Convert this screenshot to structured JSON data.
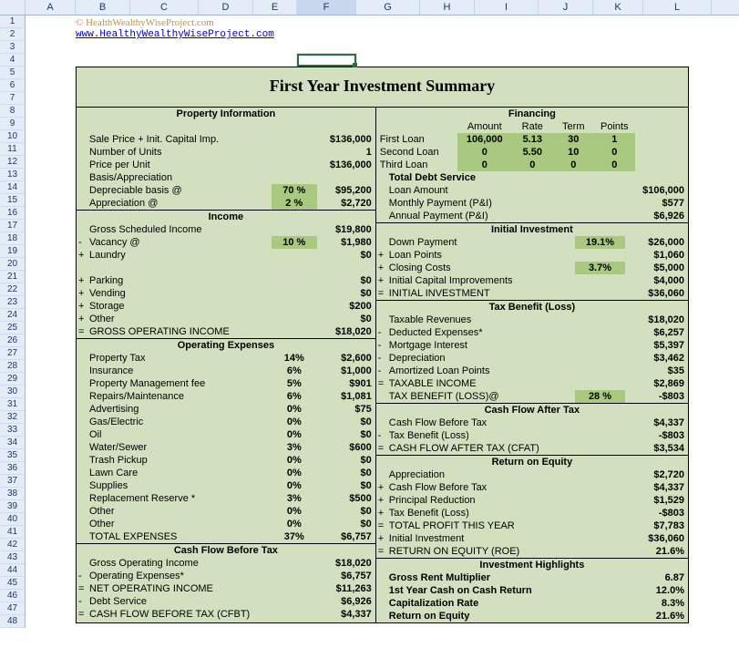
{
  "columns": [
    "",
    "A",
    "B",
    "C",
    "D",
    "E",
    "F",
    "G",
    "H",
    "I",
    "J",
    "K",
    "L"
  ],
  "rownums": [
    "1",
    "2",
    "3",
    "4",
    "5",
    "6",
    "7",
    "8",
    "9",
    "10",
    "11",
    "12",
    "13",
    "14",
    "15",
    "16",
    "17",
    "18",
    "19",
    "20",
    "21",
    "22",
    "23",
    "24",
    "25",
    "26",
    "27",
    "28",
    "29",
    "30",
    "31",
    "32",
    "33",
    "34",
    "35",
    "36",
    "37",
    "38",
    "39",
    "40",
    "41",
    "42",
    "43",
    "44",
    "45",
    "46",
    "47",
    "48"
  ],
  "copyright": "© HealthWealthyWiseProject.com",
  "weblink": "www.HealthyWealthyWiseProject.com",
  "title": "First Year Investment Summary",
  "propInfoHead": "Property Information",
  "propInfo": {
    "salePrice": {
      "lbl": "Sale Price + Init. Capital Imp.",
      "val": "$136,000"
    },
    "numUnits": {
      "lbl": "Number of Units",
      "val": "1"
    },
    "pricePerUnit": {
      "lbl": "Price per Unit",
      "val": "$136,000"
    },
    "basis": {
      "lbl": "Basis/Appreciation"
    },
    "depBasis": {
      "lbl": "Depreciable basis @",
      "pct": "70 %",
      "val": "$95,200"
    },
    "apprec": {
      "lbl": "Appreciation @",
      "pct": "2 %",
      "val": "$2,720"
    }
  },
  "incomeHead": "Income",
  "income": {
    "gsi": {
      "lbl": "Gross Scheduled Income",
      "val": "$19,800"
    },
    "vac": {
      "pfx": "-",
      "lbl": "Vacancy @",
      "pct": "10 %",
      "val": "$1,980"
    },
    "laundry": {
      "pfx": "+",
      "lbl": "Laundry",
      "val": "$0"
    },
    "parking": {
      "pfx": "+",
      "lbl": "Parking",
      "val": "$0"
    },
    "vending": {
      "pfx": "+",
      "lbl": "Vending",
      "val": "$0"
    },
    "storage": {
      "pfx": "+",
      "lbl": "Storage",
      "val": "$200"
    },
    "other": {
      "pfx": "+",
      "lbl": "Other",
      "val": "$0"
    },
    "goi": {
      "pfx": "=",
      "lbl": "GROSS OPERATING INCOME",
      "val": "$18,020"
    }
  },
  "opexHead": "Operating Expenses",
  "opex": {
    "tax": {
      "lbl": "Property Tax",
      "pct": "14%",
      "val": "$2,600"
    },
    "ins": {
      "lbl": "Insurance",
      "pct": "6%",
      "val": "$1,000"
    },
    "mgmt": {
      "lbl": "Property Management fee",
      "pct": "5%",
      "val": "$901"
    },
    "rep": {
      "lbl": "Repairs/Maintenance",
      "pct": "6%",
      "val": "$1,081"
    },
    "adv": {
      "lbl": "Advertising",
      "pct": "0%",
      "val": "$75"
    },
    "gas": {
      "lbl": "Gas/Electric",
      "pct": "0%",
      "val": "$0"
    },
    "oil": {
      "lbl": "Oil",
      "pct": "0%",
      "val": "$0"
    },
    "water": {
      "lbl": "Water/Sewer",
      "pct": "3%",
      "val": "$600"
    },
    "trash": {
      "lbl": "Trash Pickup",
      "pct": "0%",
      "val": "$0"
    },
    "lawn": {
      "lbl": "Lawn Care",
      "pct": "0%",
      "val": "$0"
    },
    "supp": {
      "lbl": "Supplies",
      "pct": "0%",
      "val": "$0"
    },
    "reserve": {
      "lbl": "Replacement Reserve *",
      "pct": "3%",
      "val": "$500"
    },
    "other1": {
      "lbl": "Other",
      "pct": "0%",
      "val": "$0"
    },
    "other2": {
      "lbl": "Other",
      "pct": "0%",
      "val": "$0"
    },
    "total": {
      "lbl": "TOTAL EXPENSES",
      "pct": "37%",
      "val": "$6,757"
    }
  },
  "cfbtHead": "Cash Flow Before Tax",
  "cfbt": {
    "goi": {
      "lbl": "Gross Operating Income",
      "val": "$18,020"
    },
    "opex": {
      "pfx": "-",
      "lbl": "Operating Expenses*",
      "val": "$6,757"
    },
    "noi": {
      "pfx": "=",
      "lbl": "NET OPERATING INCOME",
      "val": "$11,263"
    },
    "debt": {
      "pfx": "-",
      "lbl": "Debt Service",
      "val": "$6,926"
    },
    "cfbt": {
      "pfx": "=",
      "lbl": "CASH FLOW BEFORE TAX (CFBT)",
      "val": "$4,337"
    }
  },
  "finHead": "Financing",
  "finCols": {
    "amt": "Amount",
    "rate": "Rate",
    "term": "Term",
    "pts": "Points"
  },
  "fin": {
    "l1": {
      "name": "First Loan",
      "amt": "106,000",
      "rate": "5.13",
      "term": "30",
      "pts": "1"
    },
    "l2": {
      "name": "Second Loan",
      "amt": "0",
      "rate": "5.50",
      "term": "10",
      "pts": "0"
    },
    "l3": {
      "name": "Third Loan",
      "amt": "0",
      "rate": "0",
      "term": "0",
      "pts": "0"
    },
    "tds": "Total Debt Service",
    "loanAmt": {
      "lbl": "Loan Amount",
      "val": "$106,000"
    },
    "mp": {
      "lbl": "Monthly Payment (P&I)",
      "val": "$577"
    },
    "ap": {
      "lbl": "Annual Payment (P&I)",
      "val": "$6,926"
    }
  },
  "initHead": "Initial Investment",
  "init": {
    "dp": {
      "lbl": "Down Payment",
      "pct": "19.1%",
      "val": "$26,000"
    },
    "lp": {
      "pfx": "+",
      "lbl": "Loan Points",
      "val": "$1,060"
    },
    "cc": {
      "pfx": "+",
      "lbl": "Closing Costs",
      "pct": "3.7%",
      "val": "$5,000"
    },
    "ici": {
      "pfx": "+",
      "lbl": "Initial Capital Improvements",
      "val": "$4,000"
    },
    "tot": {
      "pfx": "=",
      "lbl": "INITIAL INVESTMENT",
      "val": "$36,060"
    }
  },
  "taxbHead": "Tax Benefit (Loss)",
  "taxb": {
    "rev": {
      "lbl": "Taxable Revenues",
      "val": "$18,020"
    },
    "ded": {
      "pfx": "-",
      "lbl": "Deducted Expenses*",
      "val": "$6,257"
    },
    "mi": {
      "pfx": "-",
      "lbl": "Mortgage Interest",
      "val": "$5,397"
    },
    "dep": {
      "pfx": "-",
      "lbl": "Depreciation",
      "val": "$3,462"
    },
    "alp": {
      "pfx": "-",
      "lbl": "Amortized Loan Points",
      "val": "$35"
    },
    "ti": {
      "pfx": "=",
      "lbl": "TAXABLE INCOME",
      "val": "$2,869"
    },
    "tbl": {
      "lbl": "TAX BENEFIT (LOSS)@",
      "pct": "28 %",
      "val": "-$803"
    }
  },
  "cfatHead": "Cash Flow After Tax",
  "cfat": {
    "cfbt": {
      "lbl": "Cash Flow Before Tax",
      "val": "$4,337"
    },
    "tb": {
      "pfx": "-",
      "lbl": "Tax Benefit (Loss)",
      "val": "-$803"
    },
    "cfat": {
      "pfx": "=",
      "lbl": "CASH FLOW AFTER TAX (CFAT)",
      "val": "$3,534"
    }
  },
  "roeHead": "Return on Equity",
  "roe": {
    "app": {
      "lbl": "Appreciation",
      "val": "$2,720"
    },
    "cfbt": {
      "pfx": "+",
      "lbl": "Cash Flow Before Tax",
      "val": "$4,337"
    },
    "pr": {
      "pfx": "+",
      "lbl": "Principal Reduction",
      "val": "$1,529"
    },
    "tb": {
      "pfx": "+",
      "lbl": "Tax Benefit (Loss)",
      "val": "-$803"
    },
    "tp": {
      "pfx": "=",
      "lbl": "TOTAL PROFIT THIS YEAR",
      "val": "$7,783"
    },
    "ii": {
      "pfx": "+",
      "lbl": "Initial Investment",
      "val": "$36,060"
    },
    "roe": {
      "pfx": "=",
      "lbl": "RETURN ON EQUITY (ROE)",
      "val": "21.6%"
    }
  },
  "ihHead": "Investment Highlights",
  "ih": {
    "grm": {
      "lbl": "Gross Rent Multiplier",
      "val": "6.87"
    },
    "coc": {
      "lbl": "1st Year Cash on Cash Return",
      "val": "12.0%"
    },
    "cap": {
      "lbl": "Capitalization Rate",
      "val": "8.3%"
    },
    "roe": {
      "lbl": "Return on Equity",
      "val": "21.6%"
    }
  }
}
